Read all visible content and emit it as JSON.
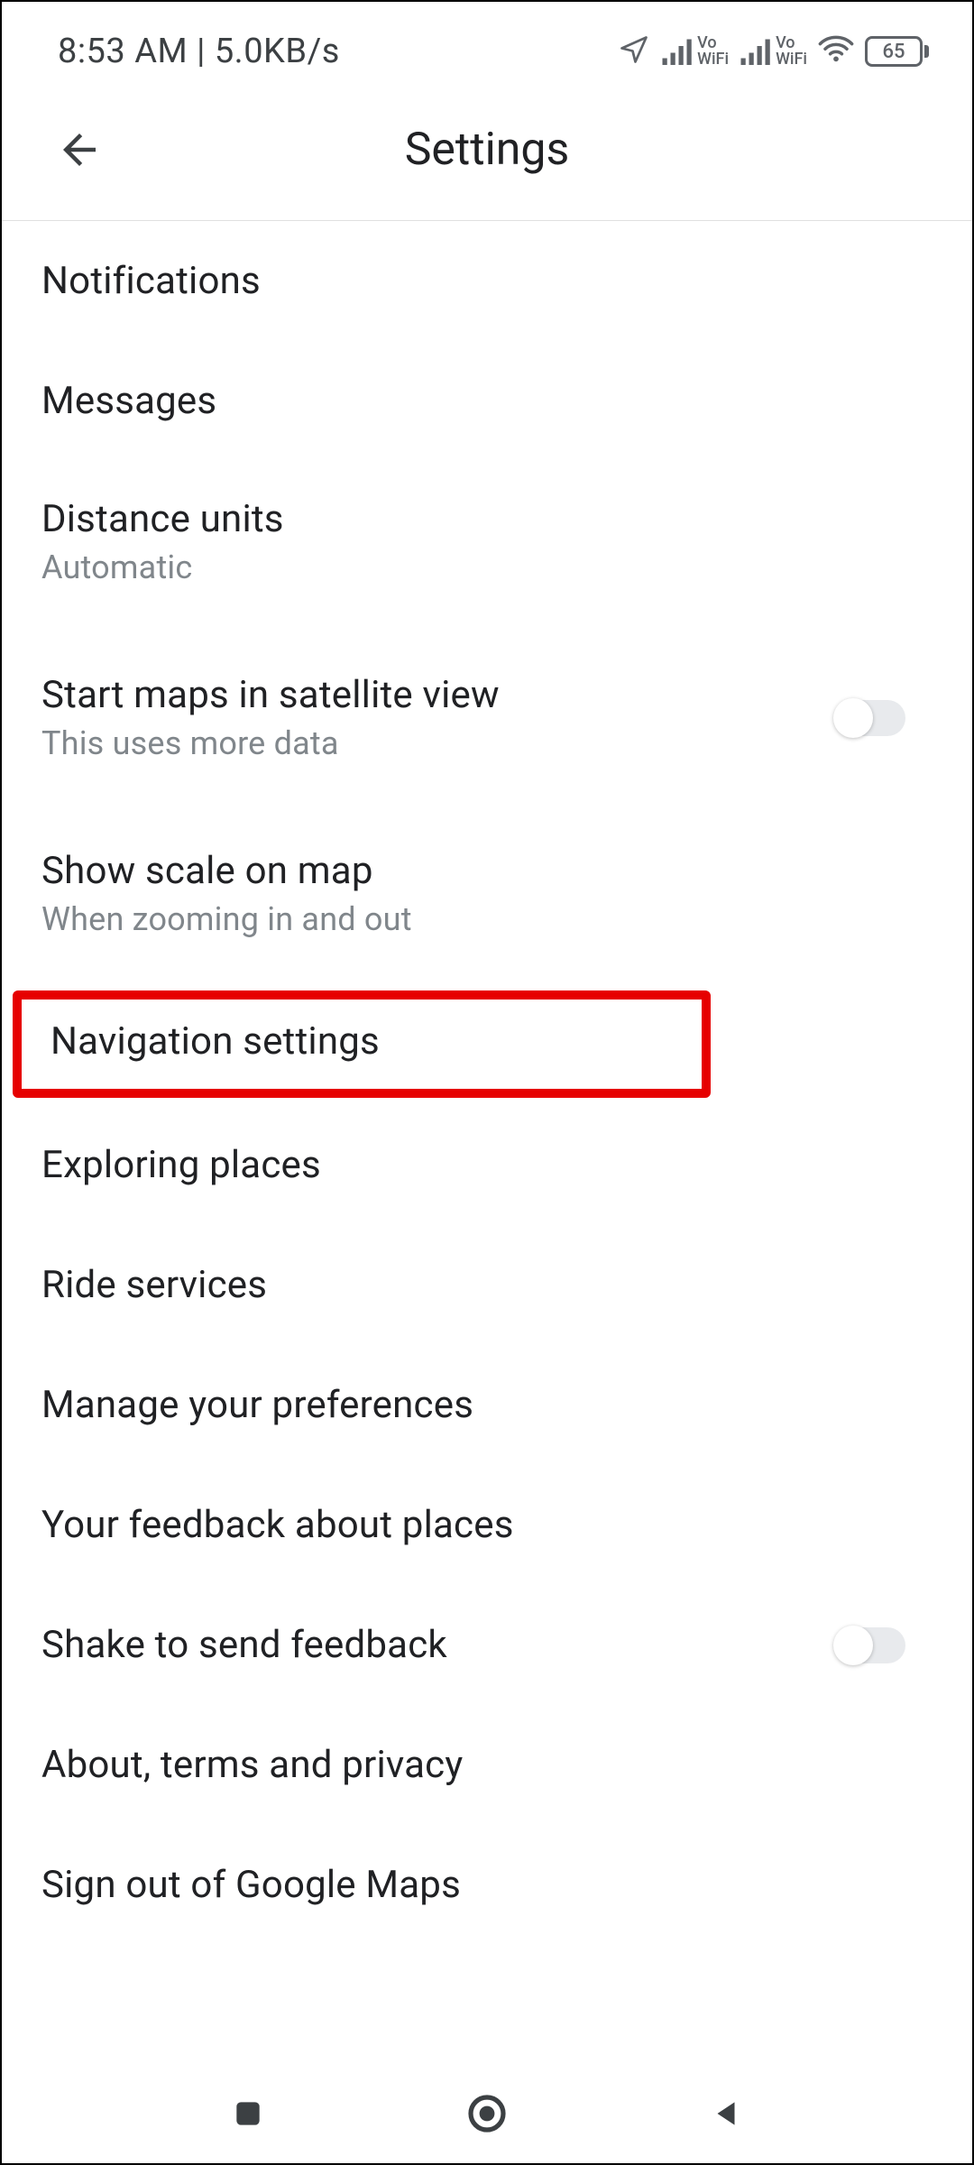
{
  "status": {
    "time": "8:53 AM",
    "separator": " | ",
    "data_rate": "5.0KB/s",
    "vo_label_top": "Vo",
    "vo_label_bottom": "WiFi",
    "battery": "65"
  },
  "header": {
    "title": "Settings"
  },
  "items": [
    {
      "title": "Notifications"
    },
    {
      "title": "Messages"
    },
    {
      "title": "Distance units",
      "subtitle": "Automatic"
    },
    {
      "title": "Start maps in satellite view",
      "subtitle": "This uses more data",
      "toggle": false
    },
    {
      "title": "Show scale on map",
      "subtitle": "When zooming in and out"
    },
    {
      "title": "Navigation settings",
      "highlighted": true
    },
    {
      "title": "Exploring places"
    },
    {
      "title": "Ride services"
    },
    {
      "title": "Manage your preferences"
    },
    {
      "title": "Your feedback about places"
    },
    {
      "title": "Shake to send feedback",
      "toggle": false
    },
    {
      "title": "About, terms and privacy"
    },
    {
      "title": "Sign out of Google Maps"
    }
  ],
  "highlight_color": "#e60000"
}
